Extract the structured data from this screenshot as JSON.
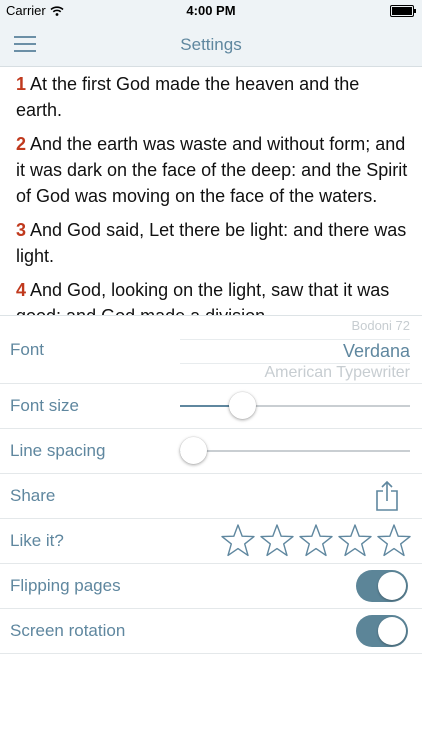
{
  "status_bar": {
    "carrier": "Carrier",
    "time": "4:00 PM"
  },
  "nav": {
    "title": "Settings"
  },
  "verses": [
    {
      "num": "1",
      "text": "At the first God made the heaven and the earth."
    },
    {
      "num": "2",
      "text": "And the earth was waste and without form; and it was dark on the face of the deep: and the Spirit of God was moving on the face of the waters."
    },
    {
      "num": "3",
      "text": "And God said, Let there be light: and there was light."
    },
    {
      "num": "4",
      "text": "And God, looking on the light, saw that it was good: and God made a division"
    }
  ],
  "settings": {
    "font": {
      "label": "Font",
      "options": [
        "Bodoni 72",
        "Verdana",
        "American Typewriter"
      ],
      "selected": "Verdana"
    },
    "font_size": {
      "label": "Font size",
      "value": 0.24
    },
    "line_spacing": {
      "label": "Line spacing",
      "value": 0.0
    },
    "share": {
      "label": "Share",
      "icon": "share-icon"
    },
    "like": {
      "label": "Like it?",
      "rating": 0,
      "max": 5
    },
    "flipping_pages": {
      "label": "Flipping pages",
      "on": true
    },
    "screen_rotation": {
      "label": "Screen rotation",
      "on": true
    }
  },
  "colors": {
    "accent": "#5f879f",
    "verse_number": "#c0391d",
    "toggle_on": "#5c8598",
    "bar_bg": "#eef3f6"
  }
}
